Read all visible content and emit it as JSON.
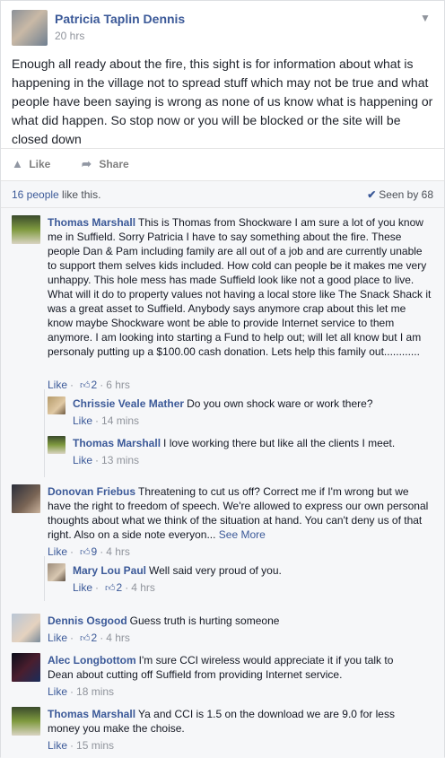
{
  "post": {
    "author": "Patricia Taplin Dennis",
    "time": "20 hrs",
    "text": "Enough all ready about the fire, this sight is for information about what is happening in the village not to spread stuff which may not be true and what people have been saying is wrong as none of us know what is happening or what did happen. So stop now or you will be blocked or the site will be closed down",
    "chevron_icon": "chevron-down-icon"
  },
  "actions": {
    "like_label": "Like",
    "share_label": "Share"
  },
  "likes": {
    "count_text": "16 people",
    "suffix": " like this.",
    "seen_label": "Seen by 68"
  },
  "comments": [
    {
      "name": "Thomas Marshall",
      "text": "This is Thomas from Shockware I am sure a lot of you know me in Suffield. Sorry Patricia I have to say something about the fire. These people Dan & Pam including family are all out of a job and are currently unable to support them selves kids included. How cold can people be it makes me very unhappy. This hole mess has made Suffield look like not a good place to live. What will it do to property values not having a local store like The Snack Shack it was a great asset to Suffield. Anybody says anymore crap about this let me know maybe Shockware wont be able to provide Internet service to them anymore. I am looking into starting a Fund to help out; will let all know but I am personaly putting up a $100.00 cash donation. Lets help this family out............",
      "like": "Like",
      "likes": "2",
      "time": "6 hrs"
    },
    {
      "name": "Chrissie Veale Mather",
      "text": "Do you own shock ware or work there?",
      "like": "Like",
      "time": "14 mins"
    },
    {
      "name": "Thomas Marshall",
      "text": "I love working there but like all the clients I meet.",
      "like": "Like",
      "time": "13 mins"
    },
    {
      "name": "Donovan Friebus",
      "text": "Threatening to cut us off? Correct me if I'm wrong but we have the right to freedom of speech. We're allowed to express our own personal thoughts about what we think of the situation at hand. You can't deny us of that right. Also on a side note everyon...",
      "see_more": "See More",
      "like": "Like",
      "likes": "9",
      "time": "4 hrs"
    },
    {
      "name": "Mary Lou Paul",
      "text": "Well said very proud of you.",
      "like": "Like",
      "likes": "2",
      "time": "4 hrs"
    },
    {
      "name": "Dennis Osgood",
      "text": "Guess truth is hurting someone",
      "like": "Like",
      "likes": "2",
      "time": "4 hrs"
    },
    {
      "name": "Alec Longbottom",
      "text": "I'm sure CCI wireless would appreciate it if you talk to Dean about cutting off Suffield from providing Internet service.",
      "like": "Like",
      "time": "18 mins"
    },
    {
      "name": "Thomas Marshall",
      "text": "Ya and CCI is 1.5 on the download we are 9.0 for less money you make the choise.",
      "like": "Like",
      "time": "15 mins"
    }
  ]
}
